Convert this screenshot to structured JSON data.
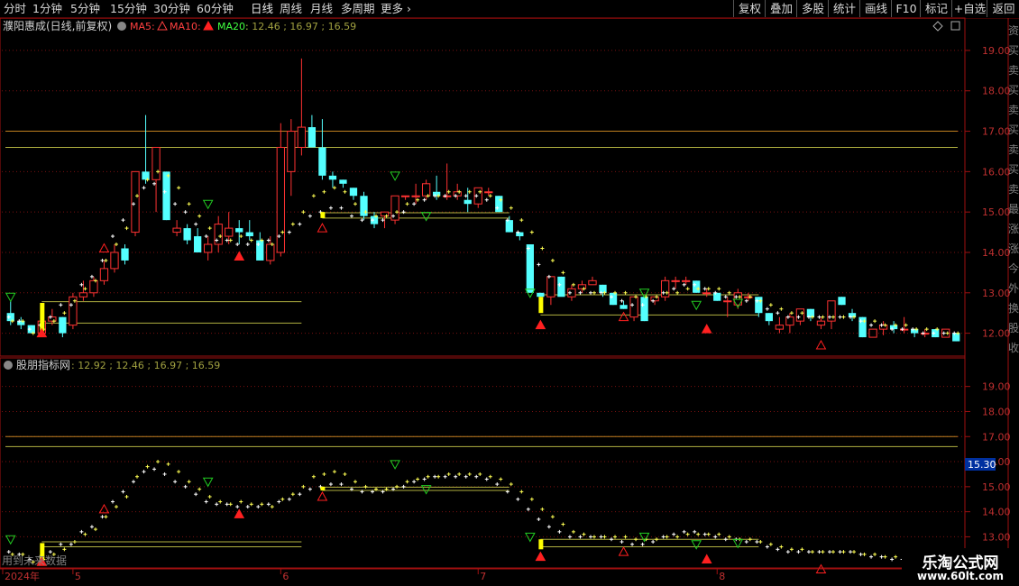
{
  "toolbar": {
    "periods": [
      "分时",
      "1分钟",
      "5分钟",
      "15分钟",
      "30分钟",
      "60分钟",
      "日线",
      "周线",
      "月线",
      "多周期"
    ],
    "active_period": "日线",
    "more_label": "更多",
    "more_arrow": "chevron-right-icon",
    "right_buttons": [
      "复权",
      "叠加",
      "多股",
      "统计",
      "画线",
      "F10",
      "标记",
      "+自选",
      "返回"
    ]
  },
  "main_panel": {
    "title": "濮阳惠成(日线,前复权)",
    "ma5_label": "MA5:",
    "ma10_label": "MA10:",
    "ma20_label": "MA20:",
    "values": ": 12.46 ; 16.97 ; 16.59",
    "diamond_icon": "diamond-icon",
    "settings_icon": "panel-settings-icon",
    "y_ticks": [
      "19.00",
      "18.00",
      "17.00",
      "16.00",
      "15.00",
      "14.00",
      "13.00",
      "12.00"
    ]
  },
  "sub_panel": {
    "title": "股朋指标网",
    "values": ": 12.92 ; 12.46 ; 16.97 ; 16.59",
    "y_ticks": [
      "19.00",
      "18.00",
      "17.00",
      "16.00",
      "15.00",
      "14.00",
      "13.00"
    ],
    "current_price": "15.30",
    "note": "用到未来数据"
  },
  "right_strip_chars": [
    "资",
    "买",
    "卖",
    "买",
    "卖",
    "买",
    "卖",
    "买",
    "卖",
    "最",
    "涨",
    "涨",
    "今",
    "外",
    "换",
    "股",
    "收"
  ],
  "x_axis": {
    "labels": [
      "2024年",
      "5",
      "6",
      "7",
      "8"
    ]
  },
  "colors": {
    "up": "#ff3232",
    "down": "#54ffff",
    "ma5": "#ffffff",
    "ma10": "#ffff54",
    "frame": "#a01010",
    "level_orange": "#c08020",
    "level_yellow": "#b0b040",
    "tri_green": "#22cc22",
    "tri_red": "#ff2020"
  },
  "chart_data": {
    "type": "candlestick",
    "y_range": [
      11.5,
      19.4
    ],
    "levels_main": [
      17.0,
      16.6
    ],
    "candles": [
      [
        12.5,
        12.8,
        12.2,
        12.3
      ],
      [
        12.3,
        12.4,
        12.1,
        12.2
      ],
      [
        12.2,
        12.2,
        12.0,
        12.0
      ],
      [
        12.0,
        12.4,
        11.95,
        12.3
      ],
      [
        12.3,
        12.6,
        12.2,
        12.4
      ],
      [
        12.4,
        12.4,
        11.9,
        12.0
      ],
      [
        12.2,
        13.0,
        12.1,
        12.9
      ],
      [
        12.9,
        13.3,
        12.8,
        13.0
      ],
      [
        13.0,
        13.4,
        12.9,
        13.3
      ],
      [
        13.3,
        13.8,
        13.2,
        13.6
      ],
      [
        13.6,
        14.2,
        13.5,
        14.0
      ],
      [
        14.1,
        14.2,
        13.7,
        13.8
      ],
      [
        14.5,
        16.0,
        14.4,
        16.0
      ],
      [
        16.0,
        17.4,
        15.7,
        15.8
      ],
      [
        15.8,
        16.6,
        15.0,
        16.6
      ],
      [
        16.0,
        16.0,
        14.8,
        14.8
      ],
      [
        14.5,
        14.8,
        14.4,
        14.6
      ],
      [
        14.6,
        14.7,
        14.2,
        14.3
      ],
      [
        14.4,
        14.6,
        14.1,
        14.0
      ],
      [
        14.0,
        14.4,
        13.8,
        14.2
      ],
      [
        14.2,
        14.9,
        14.0,
        14.7
      ],
      [
        14.4,
        15.0,
        14.2,
        14.6
      ],
      [
        14.6,
        14.8,
        14.2,
        14.5
      ],
      [
        14.5,
        14.8,
        14.3,
        14.4
      ],
      [
        14.3,
        14.5,
        13.8,
        13.8
      ],
      [
        13.8,
        14.4,
        13.7,
        14.2
      ],
      [
        14.0,
        17.2,
        13.9,
        16.6
      ],
      [
        16.0,
        17.3,
        15.4,
        17.0
      ],
      [
        16.6,
        18.8,
        16.4,
        17.1
      ],
      [
        17.1,
        17.4,
        16.6,
        16.6
      ],
      [
        16.6,
        17.3,
        15.8,
        15.9
      ],
      [
        15.9,
        16.0,
        15.6,
        15.8
      ],
      [
        15.8,
        15.8,
        15.6,
        15.7
      ],
      [
        15.6,
        15.6,
        15.3,
        15.4
      ],
      [
        15.4,
        15.5,
        14.8,
        14.9
      ],
      [
        14.9,
        15.0,
        14.6,
        14.7
      ],
      [
        14.9,
        15.0,
        14.6,
        15.0
      ],
      [
        14.8,
        15.4,
        14.7,
        15.4
      ],
      [
        15.4,
        15.4,
        15.3,
        15.4
      ],
      [
        15.4,
        15.7,
        15.2,
        15.4
      ],
      [
        15.4,
        15.8,
        15.3,
        15.7
      ],
      [
        15.5,
        15.9,
        15.3,
        15.4
      ],
      [
        15.4,
        16.2,
        15.3,
        15.4
      ],
      [
        15.4,
        15.7,
        15.3,
        15.5
      ],
      [
        15.3,
        15.6,
        15.0,
        15.2
      ],
      [
        15.2,
        15.6,
        15.1,
        15.6
      ],
      [
        15.5,
        15.6,
        15.4,
        15.5
      ],
      [
        15.4,
        15.4,
        15.0,
        15.0
      ],
      [
        14.8,
        14.9,
        14.5,
        14.5
      ],
      [
        14.5,
        14.5,
        14.3,
        14.4
      ],
      [
        14.2,
        14.2,
        13.0,
        13.0
      ],
      [
        13.0,
        13.0,
        12.9,
        12.9
      ],
      [
        12.9,
        13.4,
        12.7,
        13.4
      ],
      [
        13.4,
        13.4,
        13.2,
        12.9
      ],
      [
        12.9,
        13.2,
        12.8,
        13.1
      ],
      [
        13.1,
        13.3,
        13.0,
        13.2
      ],
      [
        13.2,
        13.4,
        13.2,
        13.3
      ],
      [
        13.2,
        13.2,
        12.9,
        13.0
      ],
      [
        13.0,
        13.0,
        12.7,
        12.7
      ],
      [
        12.7,
        12.8,
        12.6,
        12.6
      ],
      [
        12.4,
        12.9,
        12.3,
        12.9
      ],
      [
        12.9,
        12.9,
        12.3,
        12.3
      ],
      [
        12.8,
        12.9,
        12.7,
        12.9
      ],
      [
        12.9,
        13.4,
        12.8,
        13.3
      ],
      [
        13.3,
        13.4,
        13.1,
        13.3
      ],
      [
        13.3,
        13.4,
        13.2,
        13.3
      ],
      [
        13.3,
        13.3,
        13.0,
        13.0
      ],
      [
        13.0,
        13.1,
        12.9,
        13.0
      ],
      [
        13.0,
        13.0,
        12.8,
        12.8
      ],
      [
        12.8,
        12.9,
        12.4,
        12.8
      ],
      [
        12.7,
        13.1,
        12.6,
        13.0
      ],
      [
        12.9,
        13.0,
        12.8,
        12.9
      ],
      [
        12.9,
        12.9,
        12.4,
        12.5
      ],
      [
        12.5,
        12.5,
        12.2,
        12.3
      ],
      [
        12.1,
        12.4,
        12.0,
        12.2
      ],
      [
        12.2,
        12.5,
        12.0,
        12.4
      ],
      [
        12.3,
        12.6,
        12.2,
        12.6
      ],
      [
        12.6,
        12.6,
        12.3,
        12.4
      ],
      [
        12.2,
        12.4,
        12.1,
        12.3
      ],
      [
        12.3,
        12.8,
        12.1,
        12.8
      ],
      [
        12.9,
        12.9,
        12.7,
        12.7
      ],
      [
        12.5,
        12.6,
        12.3,
        12.4
      ],
      [
        12.4,
        12.4,
        11.9,
        11.9
      ],
      [
        11.9,
        12.1,
        11.9,
        12.1
      ],
      [
        12.1,
        12.3,
        11.95,
        12.2
      ],
      [
        12.2,
        12.3,
        12.0,
        12.1
      ],
      [
        12.1,
        12.4,
        12.0,
        12.1
      ],
      [
        12.1,
        12.1,
        11.9,
        12.0
      ],
      [
        12.0,
        12.1,
        11.9,
        12.0
      ],
      [
        12.1,
        12.1,
        11.9,
        11.9
      ],
      [
        11.9,
        12.1,
        11.9,
        12.1
      ],
      [
        12.0,
        12.0,
        11.8,
        11.8
      ]
    ],
    "cross_prices": [
      [
        12.4,
        12.3
      ],
      [
        12.3,
        12.3
      ],
      [
        12.1,
        12.0
      ],
      [
        12.2,
        12.1
      ],
      [
        12.4,
        12.3
      ],
      [
        12.7,
        12.5
      ],
      [
        12.7,
        12.8
      ],
      [
        13.2,
        13.1
      ],
      [
        13.4,
        13.3
      ],
      [
        13.8,
        13.8
      ],
      [
        14.4,
        14.2
      ],
      [
        14.8,
        14.6
      ],
      [
        15.2,
        15.4
      ],
      [
        15.6,
        15.8
      ],
      [
        15.7,
        16.0
      ],
      [
        15.5,
        15.9
      ],
      [
        15.2,
        15.6
      ],
      [
        15.0,
        15.2
      ],
      [
        14.7,
        14.9
      ],
      [
        14.4,
        14.6
      ],
      [
        14.3,
        14.4
      ],
      [
        14.3,
        14.3
      ],
      [
        14.2,
        14.4
      ],
      [
        14.2,
        14.3
      ],
      [
        14.2,
        14.3
      ],
      [
        14.3,
        14.2
      ],
      [
        14.4,
        14.5
      ],
      [
        14.5,
        14.7
      ],
      [
        14.7,
        15.0
      ],
      [
        14.9,
        15.4
      ],
      [
        15.0,
        15.5
      ],
      [
        15.1,
        15.6
      ],
      [
        15.1,
        15.5
      ],
      [
        14.9,
        15.2
      ],
      [
        14.8,
        15.0
      ],
      [
        14.8,
        14.9
      ],
      [
        14.8,
        14.9
      ],
      [
        14.9,
        15.0
      ],
      [
        15.0,
        15.2
      ],
      [
        15.2,
        15.3
      ],
      [
        15.3,
        15.4
      ],
      [
        15.4,
        15.4
      ],
      [
        15.4,
        15.5
      ],
      [
        15.4,
        15.5
      ],
      [
        15.4,
        15.5
      ],
      [
        15.4,
        15.5
      ],
      [
        15.3,
        15.4
      ],
      [
        15.1,
        15.3
      ],
      [
        14.8,
        15.1
      ],
      [
        14.5,
        14.8
      ],
      [
        14.1,
        14.5
      ],
      [
        13.7,
        14.1
      ],
      [
        13.4,
        13.8
      ],
      [
        13.2,
        13.5
      ],
      [
        13.0,
        13.2
      ],
      [
        13.0,
        13.1
      ],
      [
        13.0,
        13.0
      ],
      [
        13.0,
        13.0
      ],
      [
        12.9,
        13.0
      ],
      [
        12.8,
        13.0
      ],
      [
        12.7,
        12.9
      ],
      [
        12.7,
        12.9
      ],
      [
        12.8,
        12.9
      ],
      [
        13.0,
        13.0
      ],
      [
        13.1,
        13.0
      ],
      [
        13.2,
        13.1
      ],
      [
        13.2,
        13.1
      ],
      [
        13.1,
        13.1
      ],
      [
        13.0,
        13.1
      ],
      [
        12.9,
        13.0
      ],
      [
        12.9,
        12.9
      ],
      [
        12.8,
        12.9
      ],
      [
        12.8,
        12.8
      ],
      [
        12.6,
        12.7
      ],
      [
        12.5,
        12.6
      ],
      [
        12.4,
        12.5
      ],
      [
        12.4,
        12.5
      ],
      [
        12.4,
        12.4
      ],
      [
        12.4,
        12.4
      ],
      [
        12.4,
        12.4
      ],
      [
        12.4,
        12.4
      ],
      [
        12.4,
        12.4
      ],
      [
        12.3,
        12.3
      ],
      [
        12.2,
        12.3
      ],
      [
        12.2,
        12.2
      ],
      [
        12.1,
        12.2
      ],
      [
        12.1,
        12.2
      ],
      [
        12.1,
        12.1
      ],
      [
        12.0,
        12.1
      ],
      [
        12.0,
        12.1
      ],
      [
        12.0,
        12.0
      ],
      [
        12.0,
        12.0
      ]
    ],
    "yellow_signals": [
      [
        3,
        12.05,
        12.75
      ],
      [
        30,
        14.85,
        15.0
      ],
      [
        51,
        12.5,
        12.9
      ]
    ],
    "green_triangles": [
      [
        0,
        12.9
      ],
      [
        19,
        15.2
      ],
      [
        37,
        15.9
      ],
      [
        40,
        14.9
      ],
      [
        50,
        13.0
      ],
      [
        61,
        13.0
      ],
      [
        66,
        12.7
      ],
      [
        70,
        12.75
      ]
    ],
    "red_triangles": [
      [
        3,
        12.0
      ],
      [
        9,
        14.1
      ],
      [
        22,
        13.9
      ],
      [
        30,
        14.6
      ],
      [
        51,
        12.2
      ],
      [
        59,
        12.4
      ],
      [
        67,
        12.1
      ],
      [
        78,
        11.7
      ]
    ],
    "channels_main": [
      [
        3,
        28,
        12.25,
        12.78
      ],
      [
        30,
        48,
        14.85,
        14.98
      ],
      [
        51,
        72,
        12.45,
        12.95
      ]
    ],
    "sub_y_range": [
      11.9,
      19.6
    ],
    "channels_sub": [
      [
        3,
        28,
        12.6,
        12.8
      ],
      [
        30,
        48,
        14.85,
        14.98
      ],
      [
        51,
        72,
        12.6,
        12.9
      ]
    ],
    "x_label_indices": [
      0,
      6,
      26,
      45,
      68
    ]
  }
}
